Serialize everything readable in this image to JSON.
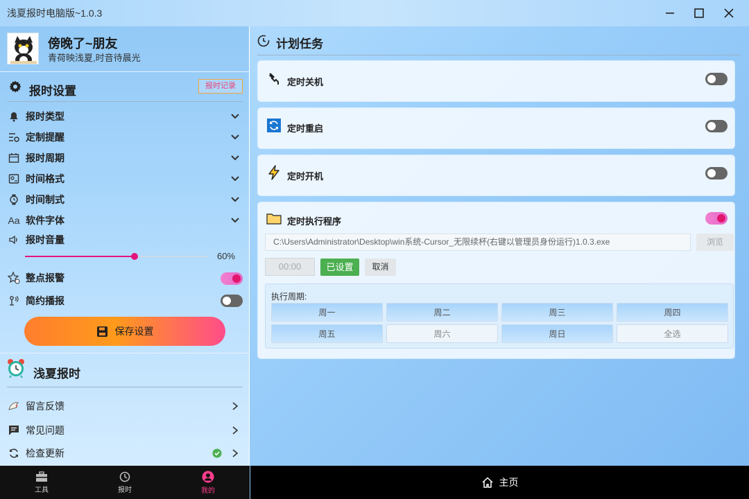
{
  "window": {
    "title": "浅夏报时电脑版~1.0.3"
  },
  "profile": {
    "name": "傍晚了~朋友",
    "motto": "青荷映浅夏,时音待晨光"
  },
  "settings": {
    "title": "报时设置",
    "record_button": "报时记录",
    "items": [
      {
        "label": "报时类型",
        "icon": "bell-icon"
      },
      {
        "label": "定制提醒",
        "icon": "custom-reminder-icon"
      },
      {
        "label": "报时周期",
        "icon": "calendar-icon"
      },
      {
        "label": "时间格式",
        "icon": "time-format-icon"
      },
      {
        "label": "时间制式",
        "icon": "watch-icon"
      },
      {
        "label": "软件字体",
        "icon": "font-icon"
      }
    ],
    "volume_label": "报时音量",
    "volume_value": "60%",
    "volume_fraction": 0.6,
    "hourly_label": "整点报警",
    "hourly_on": true,
    "simple_label": "简约播报",
    "simple_on": false,
    "save_button": "保存设置"
  },
  "about": {
    "title": "浅夏报时",
    "items": [
      {
        "label": "留言反馈",
        "icon": "feedback-icon"
      },
      {
        "label": "常见问题",
        "icon": "faq-icon"
      },
      {
        "label": "检查更新",
        "icon": "refresh-icon",
        "status_icon": "check-circle-icon"
      }
    ]
  },
  "bottom_nav": {
    "tabs": [
      {
        "label": "工具",
        "icon": "toolbox-icon",
        "active": false
      },
      {
        "label": "报时",
        "icon": "clock-icon",
        "active": false
      },
      {
        "label": "我的",
        "icon": "user-icon",
        "active": true
      }
    ],
    "home_label": "主页"
  },
  "tasks": {
    "title": "计划任务",
    "shutdown": {
      "label": "定时关机",
      "on": false
    },
    "restart": {
      "label": "定时重启",
      "on": false
    },
    "poweron": {
      "label": "定时开机",
      "on": false
    },
    "program": {
      "label": "定时执行程序",
      "on": true,
      "path": "C:\\Users\\Administrator\\Desktop\\win系统-Cursor_无限续杯(右键以管理员身份运行)1.0.3.exe",
      "browse_button": "浏览",
      "time_value": "00:00",
      "set_button": "已设置",
      "cancel_button": "取消",
      "cycle_label": "执行周期:",
      "days": [
        "周一",
        "周二",
        "周三",
        "周四",
        "周五",
        "周六",
        "周日",
        "全选"
      ],
      "days_selected": [
        true,
        true,
        true,
        true,
        true,
        false,
        true,
        false
      ]
    }
  },
  "colors": {
    "accent_pink": "#e5157e",
    "save_gradient_start": "#ff7e2e",
    "save_gradient_end": "#ff4d8a",
    "set_green": "#4caf50"
  }
}
